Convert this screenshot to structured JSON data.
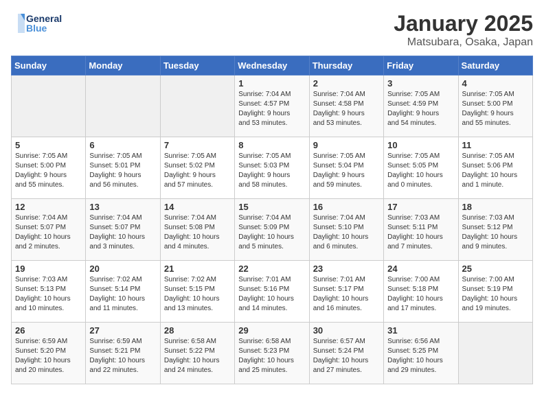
{
  "logo": {
    "line1": "General",
    "line2": "Blue"
  },
  "title": "January 2025",
  "subtitle": "Matsubara, Osaka, Japan",
  "days_of_week": [
    "Sunday",
    "Monday",
    "Tuesday",
    "Wednesday",
    "Thursday",
    "Friday",
    "Saturday"
  ],
  "weeks": [
    [
      {
        "day": "",
        "info": ""
      },
      {
        "day": "",
        "info": ""
      },
      {
        "day": "",
        "info": ""
      },
      {
        "day": "1",
        "info": "Sunrise: 7:04 AM\nSunset: 4:57 PM\nDaylight: 9 hours\nand 53 minutes."
      },
      {
        "day": "2",
        "info": "Sunrise: 7:04 AM\nSunset: 4:58 PM\nDaylight: 9 hours\nand 53 minutes."
      },
      {
        "day": "3",
        "info": "Sunrise: 7:05 AM\nSunset: 4:59 PM\nDaylight: 9 hours\nand 54 minutes."
      },
      {
        "day": "4",
        "info": "Sunrise: 7:05 AM\nSunset: 5:00 PM\nDaylight: 9 hours\nand 55 minutes."
      }
    ],
    [
      {
        "day": "5",
        "info": "Sunrise: 7:05 AM\nSunset: 5:00 PM\nDaylight: 9 hours\nand 55 minutes."
      },
      {
        "day": "6",
        "info": "Sunrise: 7:05 AM\nSunset: 5:01 PM\nDaylight: 9 hours\nand 56 minutes."
      },
      {
        "day": "7",
        "info": "Sunrise: 7:05 AM\nSunset: 5:02 PM\nDaylight: 9 hours\nand 57 minutes."
      },
      {
        "day": "8",
        "info": "Sunrise: 7:05 AM\nSunset: 5:03 PM\nDaylight: 9 hours\nand 58 minutes."
      },
      {
        "day": "9",
        "info": "Sunrise: 7:05 AM\nSunset: 5:04 PM\nDaylight: 9 hours\nand 59 minutes."
      },
      {
        "day": "10",
        "info": "Sunrise: 7:05 AM\nSunset: 5:05 PM\nDaylight: 10 hours\nand 0 minutes."
      },
      {
        "day": "11",
        "info": "Sunrise: 7:05 AM\nSunset: 5:06 PM\nDaylight: 10 hours\nand 1 minute."
      }
    ],
    [
      {
        "day": "12",
        "info": "Sunrise: 7:04 AM\nSunset: 5:07 PM\nDaylight: 10 hours\nand 2 minutes."
      },
      {
        "day": "13",
        "info": "Sunrise: 7:04 AM\nSunset: 5:07 PM\nDaylight: 10 hours\nand 3 minutes."
      },
      {
        "day": "14",
        "info": "Sunrise: 7:04 AM\nSunset: 5:08 PM\nDaylight: 10 hours\nand 4 minutes."
      },
      {
        "day": "15",
        "info": "Sunrise: 7:04 AM\nSunset: 5:09 PM\nDaylight: 10 hours\nand 5 minutes."
      },
      {
        "day": "16",
        "info": "Sunrise: 7:04 AM\nSunset: 5:10 PM\nDaylight: 10 hours\nand 6 minutes."
      },
      {
        "day": "17",
        "info": "Sunrise: 7:03 AM\nSunset: 5:11 PM\nDaylight: 10 hours\nand 7 minutes."
      },
      {
        "day": "18",
        "info": "Sunrise: 7:03 AM\nSunset: 5:12 PM\nDaylight: 10 hours\nand 9 minutes."
      }
    ],
    [
      {
        "day": "19",
        "info": "Sunrise: 7:03 AM\nSunset: 5:13 PM\nDaylight: 10 hours\nand 10 minutes."
      },
      {
        "day": "20",
        "info": "Sunrise: 7:02 AM\nSunset: 5:14 PM\nDaylight: 10 hours\nand 11 minutes."
      },
      {
        "day": "21",
        "info": "Sunrise: 7:02 AM\nSunset: 5:15 PM\nDaylight: 10 hours\nand 13 minutes."
      },
      {
        "day": "22",
        "info": "Sunrise: 7:01 AM\nSunset: 5:16 PM\nDaylight: 10 hours\nand 14 minutes."
      },
      {
        "day": "23",
        "info": "Sunrise: 7:01 AM\nSunset: 5:17 PM\nDaylight: 10 hours\nand 16 minutes."
      },
      {
        "day": "24",
        "info": "Sunrise: 7:00 AM\nSunset: 5:18 PM\nDaylight: 10 hours\nand 17 minutes."
      },
      {
        "day": "25",
        "info": "Sunrise: 7:00 AM\nSunset: 5:19 PM\nDaylight: 10 hours\nand 19 minutes."
      }
    ],
    [
      {
        "day": "26",
        "info": "Sunrise: 6:59 AM\nSunset: 5:20 PM\nDaylight: 10 hours\nand 20 minutes."
      },
      {
        "day": "27",
        "info": "Sunrise: 6:59 AM\nSunset: 5:21 PM\nDaylight: 10 hours\nand 22 minutes."
      },
      {
        "day": "28",
        "info": "Sunrise: 6:58 AM\nSunset: 5:22 PM\nDaylight: 10 hours\nand 24 minutes."
      },
      {
        "day": "29",
        "info": "Sunrise: 6:58 AM\nSunset: 5:23 PM\nDaylight: 10 hours\nand 25 minutes."
      },
      {
        "day": "30",
        "info": "Sunrise: 6:57 AM\nSunset: 5:24 PM\nDaylight: 10 hours\nand 27 minutes."
      },
      {
        "day": "31",
        "info": "Sunrise: 6:56 AM\nSunset: 5:25 PM\nDaylight: 10 hours\nand 29 minutes."
      },
      {
        "day": "",
        "info": ""
      }
    ]
  ]
}
